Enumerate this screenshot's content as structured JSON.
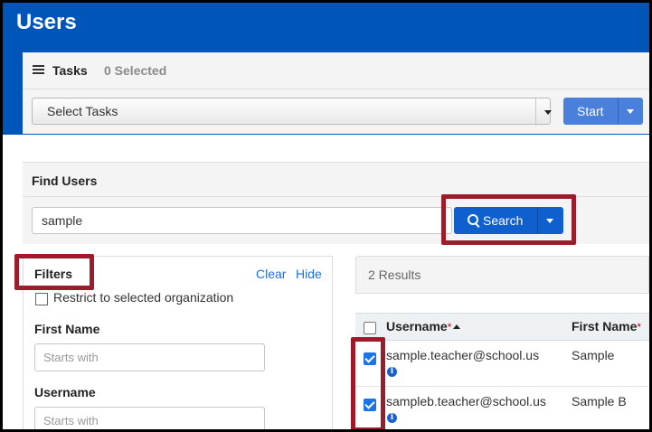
{
  "page": {
    "title": "Users"
  },
  "tasks": {
    "label": "Tasks",
    "selected_count": "0 Selected",
    "select_value": "Select Tasks",
    "start_label": "Start"
  },
  "find": {
    "title": "Find Users",
    "search_value": "sample",
    "search_label": "Search"
  },
  "filters": {
    "title": "Filters",
    "clear_label": "Clear",
    "hide_label": "Hide",
    "restrict_label": "Restrict to selected organization",
    "restrict_checked": false,
    "fields": [
      {
        "label": "First Name",
        "placeholder": "Starts with"
      },
      {
        "label": "Username",
        "placeholder": "Starts with"
      }
    ]
  },
  "results": {
    "count_text": "2 Results",
    "columns": [
      {
        "label": "Username",
        "required_mark": "*"
      },
      {
        "label": "First Name",
        "required_mark": "*"
      }
    ],
    "rows": [
      {
        "checked": true,
        "username": "sample.teacher@school.us",
        "first_name": "Sample"
      },
      {
        "checked": true,
        "username": "sampleb.teacher@school.us",
        "first_name": "Sample B"
      }
    ]
  },
  "colors": {
    "header_blue": "#0056b8",
    "button_blue": "#0f5fcf",
    "start_blue": "#4a7fdc",
    "highlight": "#9c1c2c",
    "link_blue": "#1d6fe0"
  }
}
